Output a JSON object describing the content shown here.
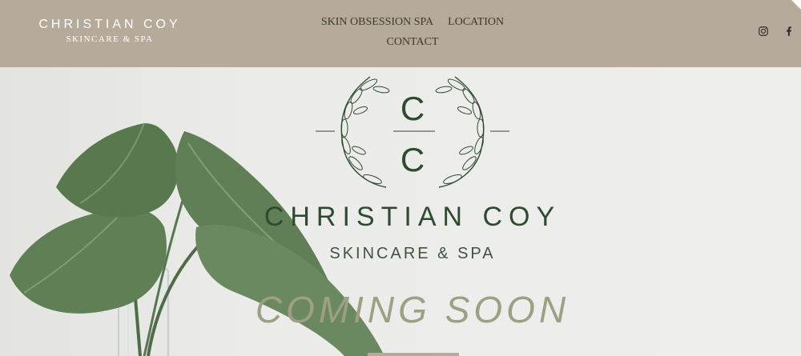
{
  "header": {
    "brand_title": "CHRISTIAN COY",
    "brand_subtitle": "SKINCARE & SPA",
    "nav": [
      {
        "label": "SKIN OBSESSION SPA"
      },
      {
        "label": "LOCATION"
      },
      {
        "label": "CONTACT"
      }
    ],
    "social": [
      {
        "icon": "instagram-icon"
      },
      {
        "icon": "facebook-icon"
      }
    ]
  },
  "hero": {
    "monogram": [
      "C",
      "C"
    ],
    "title": "CHRISTIAN COY",
    "subtitle": "SKINCARE & SPA",
    "announcement": "COMING SOON"
  },
  "colors": {
    "header_bg": "#b6ab9b",
    "hero_bg": "#eaeae7",
    "brand_green": "#2f4a2f",
    "announcement": "#9ea083"
  }
}
